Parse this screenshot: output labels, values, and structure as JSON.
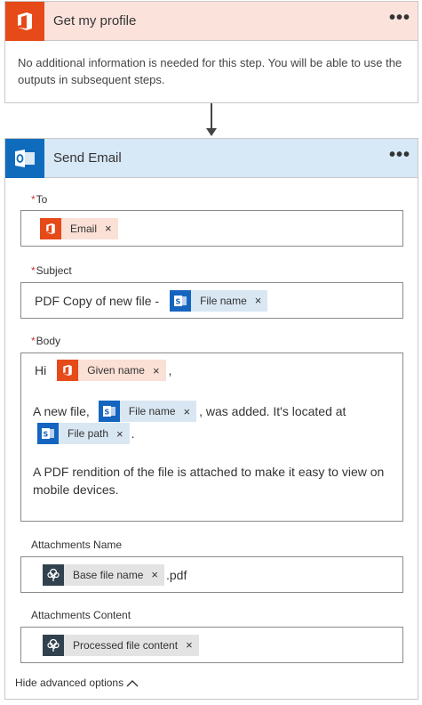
{
  "profile_card": {
    "title": "Get my profile",
    "more_label": "•••",
    "description": "No additional information is needed for this step. You will be able to use the outputs in subsequent steps."
  },
  "email_card": {
    "title": "Send Email",
    "more_label": "•••",
    "fields": {
      "to": {
        "label": "To",
        "required": "*",
        "token": "Email"
      },
      "subject": {
        "label": "Subject",
        "required": "*",
        "prefix": "PDF Copy of new file -",
        "token": "File name"
      },
      "body": {
        "label": "Body",
        "required": "*",
        "greeting": "Hi",
        "token_given_name": "Given name",
        "comma": ",",
        "line2_prefix": "A new file,",
        "token_file_name": "File name",
        "line2_suffix": ", was added. It's located at",
        "token_file_path": "File path",
        "line3_suffix": ".",
        "paragraph": "A PDF rendition of the file is attached to make it easy to view on mobile devices."
      },
      "attachments_name": {
        "label": "Attachments Name",
        "token": "Base file name",
        "suffix": ".pdf"
      },
      "attachments_content": {
        "label": "Attachments Content",
        "token": "Processed file content"
      }
    },
    "advanced_toggle": "Hide advanced options",
    "token_close": "×"
  },
  "icons": {
    "office": "office-icon",
    "outlook": "outlook-icon",
    "sharepoint": "sharepoint-icon",
    "content_conversion": "tree-icon",
    "more": "more-icon",
    "chevron_up": "chevron-up-icon"
  },
  "colors": {
    "office_red": "#e64a19",
    "outlook_blue": "#0f6cbd",
    "profile_header_bg": "#fbe3dc",
    "email_header_bg": "#d7e8f6",
    "required_red": "#d13438"
  }
}
